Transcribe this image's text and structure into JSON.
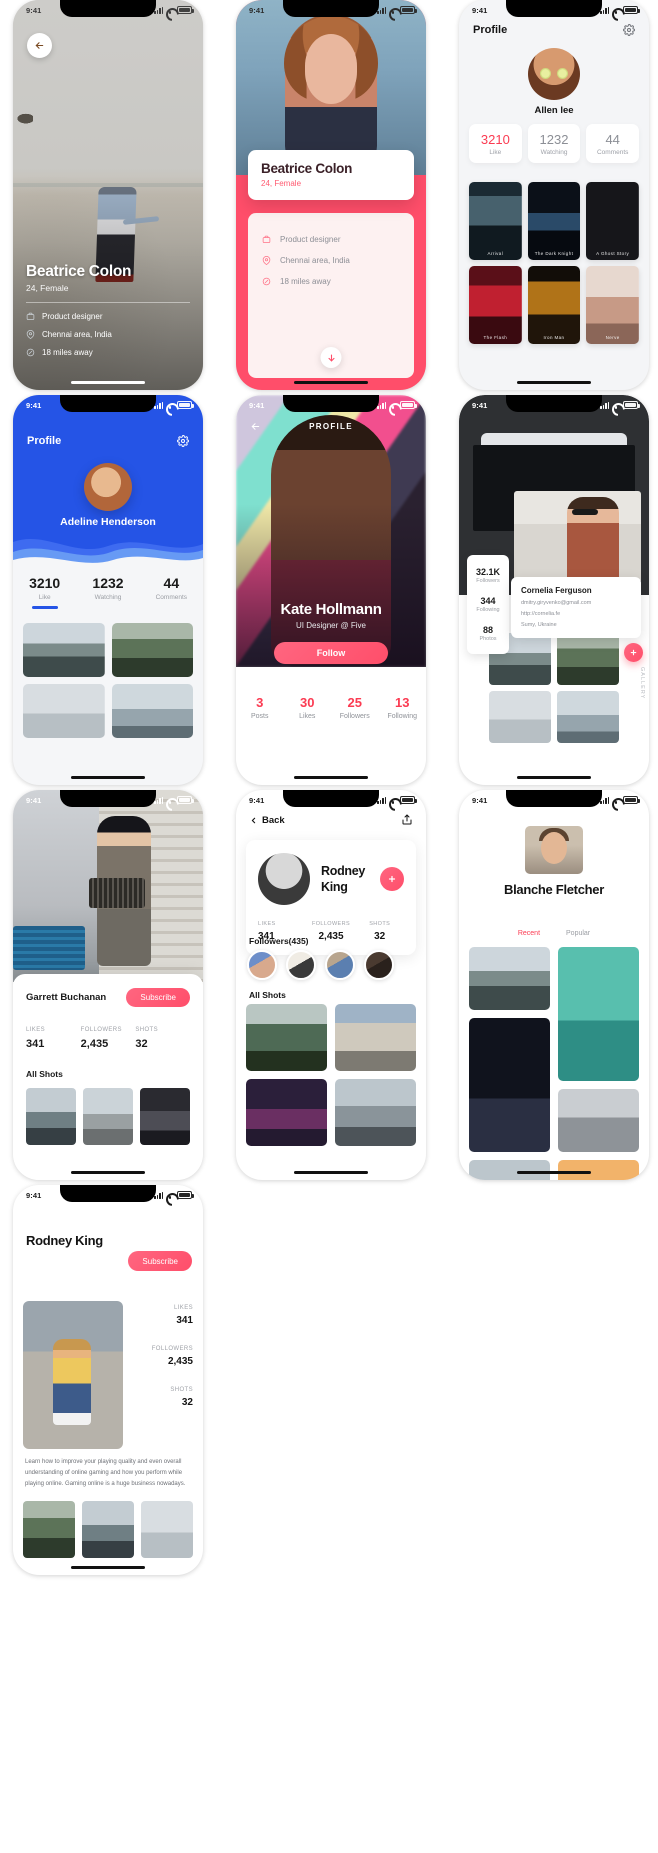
{
  "status_bar": {
    "time": "9:41",
    "icons": [
      "signal-icon",
      "wifi-icon",
      "battery-icon"
    ]
  },
  "screens": [
    {
      "id": "profile-photo-fullbleed",
      "back_icon": "arrow-left-icon",
      "name": "Beatrice Colon",
      "subtitle": "24, Female",
      "details": [
        {
          "icon": "briefcase-icon",
          "text": "Product designer"
        },
        {
          "icon": "map-pin-icon",
          "text": "Chennai area, India"
        },
        {
          "icon": "navigation-icon",
          "text": "18 miles away"
        }
      ]
    },
    {
      "id": "profile-card-pink",
      "name": "Beatrice Colon",
      "subtitle": "24, Female",
      "details": [
        {
          "icon": "briefcase-icon",
          "text": "Product designer"
        },
        {
          "icon": "map-pin-icon",
          "text": "Chennai area, India"
        },
        {
          "icon": "navigation-icon",
          "text": "18 miles away"
        }
      ],
      "scroll_icon": "arrow-down-icon",
      "accent": "#FF4E6A"
    },
    {
      "id": "profile-movies-light",
      "title": "Profile",
      "settings_icon": "gear-icon",
      "name": "Allen lee",
      "stats": [
        {
          "value": "3210",
          "label": "Like",
          "active": true
        },
        {
          "value": "1232",
          "label": "Watching",
          "active": false
        },
        {
          "value": "44",
          "label": "Comments",
          "active": false
        }
      ],
      "posters": [
        "Arrival",
        "The Dark Knight",
        "A Ghost Story",
        "The Flash",
        "Iron Man",
        "Nerve"
      ],
      "accent": "#FB3B52"
    },
    {
      "id": "profile-blue-wave",
      "title": "Profile",
      "settings_icon": "gear-icon",
      "name": "Adeline Henderson",
      "stats": [
        {
          "value": "3210",
          "label": "Like",
          "active": true
        },
        {
          "value": "1232",
          "label": "Watching",
          "active": false
        },
        {
          "value": "44",
          "label": "Comments",
          "active": false
        }
      ],
      "accent": "#2554E6"
    },
    {
      "id": "profile-hero-follow",
      "back_icon": "arrow-left-icon",
      "title": "PROFILE",
      "name": "Kate Hollmann",
      "role": "UI Designer @ Five",
      "follow_label": "Follow",
      "stats": [
        {
          "value": "3",
          "label": "Posts"
        },
        {
          "value": "30",
          "label": "Likes"
        },
        {
          "value": "25",
          "label": "Followers"
        },
        {
          "value": "13",
          "label": "Following"
        }
      ],
      "accent": "#FB3B52"
    },
    {
      "id": "profile-card-overlay",
      "side_stats": [
        {
          "value": "32.1K",
          "label": "Followers"
        },
        {
          "value": "344",
          "label": "Following"
        },
        {
          "value": "88",
          "label": "Photos"
        }
      ],
      "name": "Cornelia Ferguson",
      "email": "dmitry.giryvenko@gmail.com",
      "website": "http://cornelia.fe",
      "location": "Sumy, Ukraine",
      "fab_icon": "plus-icon",
      "vertical_label": "GALLERY",
      "accent": "#FB3B52"
    },
    {
      "id": "profile-subscribe-shots",
      "name": "Garrett Buchanan",
      "subscribe_label": "Subscribe",
      "stats": [
        {
          "label": "LIKES",
          "value": "341"
        },
        {
          "label": "FOLLOWERS",
          "value": "2,435"
        },
        {
          "label": "SHOTS",
          "value": "32"
        }
      ],
      "section_title": "All Shots",
      "accent": "#FB5C72"
    },
    {
      "id": "profile-followers-list",
      "back_label": "Back",
      "back_icon": "chevron-left-icon",
      "share_icon": "share-icon",
      "name": "Rodney King",
      "add_icon": "plus-icon",
      "stats": [
        {
          "label": "LIKES",
          "value": "341"
        },
        {
          "label": "FOLLOWERS",
          "value": "2,435"
        },
        {
          "label": "SHOTS",
          "value": "32"
        }
      ],
      "followers_title": "Followers(435)",
      "section_title": "All Shots",
      "accent": "#FB3B52"
    },
    {
      "id": "profile-masonry-tabs",
      "name": "Blanche Fletcher",
      "tabs": [
        {
          "label": "Recent",
          "active": true
        },
        {
          "label": "Popular",
          "active": false
        }
      ],
      "accent": "#FB3B52"
    },
    {
      "id": "profile-bio-shots",
      "name": "Rodney King",
      "subscribe_label": "Subscribe",
      "stats": [
        {
          "label": "LIKES",
          "value": "341"
        },
        {
          "label": "FOLLOWERS",
          "value": "2,435"
        },
        {
          "label": "SHOTS",
          "value": "32"
        }
      ],
      "bio": "Learn how to improve your playing quality and even overall understanding of online gaming and how you perform while playing online. Gaming online is a huge business nowadays.",
      "accent": "#FB5C72"
    }
  ]
}
